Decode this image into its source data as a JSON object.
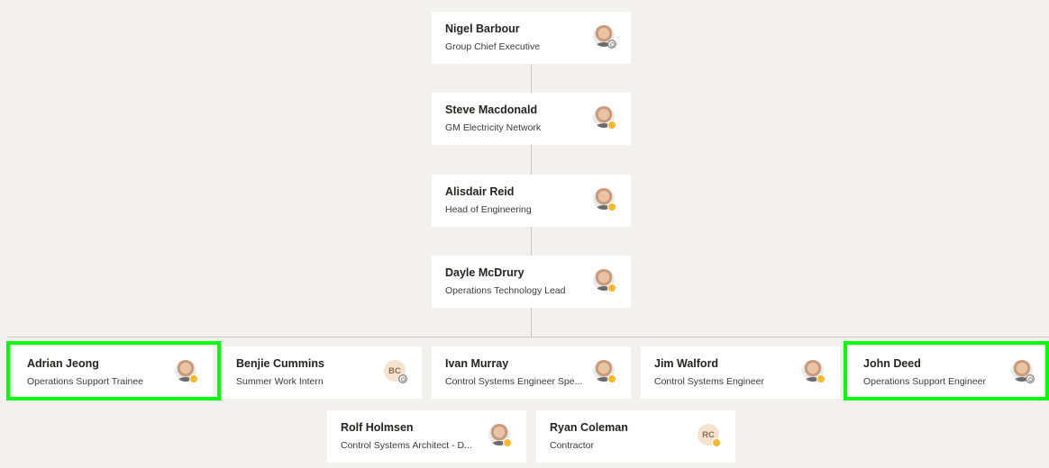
{
  "chain": [
    {
      "name": "Nigel Barbour",
      "title": "Group Chief Executive",
      "avatar": "photo",
      "presence": "offline"
    },
    {
      "name": "Steve Macdonald",
      "title": "GM Electricity Network",
      "avatar": "photo",
      "presence": "away"
    },
    {
      "name": "Alisdair Reid",
      "title": "Head of Engineering",
      "avatar": "photo",
      "presence": "away"
    },
    {
      "name": "Dayle McDrury",
      "title": "Operations Technology Lead",
      "avatar": "photo",
      "presence": "away"
    }
  ],
  "reports_row1": [
    {
      "name": "Adrian Jeong",
      "title": "Operations Support Trainee",
      "avatar": "photo",
      "presence": "away",
      "highlighted": true
    },
    {
      "name": "Benjie Cummins",
      "title": "Summer Work Intern",
      "avatar": "initials",
      "initials": "BC",
      "presence": "offline",
      "highlighted": false
    },
    {
      "name": "Ivan Murray",
      "title": "Control Systems Engineer Spe...",
      "avatar": "photo",
      "presence": "away",
      "highlighted": false
    },
    {
      "name": "Jim Walford",
      "title": "Control Systems Engineer",
      "avatar": "photo",
      "presence": "away",
      "highlighted": false
    },
    {
      "name": "John Deed",
      "title": "Operations Support Engineer",
      "avatar": "photo",
      "presence": "offline",
      "highlighted": true
    }
  ],
  "reports_row2": [
    {
      "name": "Rolf Holmsen",
      "title": "Control Systems Architect - D...",
      "avatar": "photo",
      "presence": "away"
    },
    {
      "name": "Ryan Coleman",
      "title": "Contractor",
      "avatar": "initials",
      "initials": "RC",
      "presence": "away"
    }
  ],
  "colors": {
    "highlight": "#00ff00",
    "presence_away": "#fcb72a",
    "background": "#f2f1f0"
  }
}
